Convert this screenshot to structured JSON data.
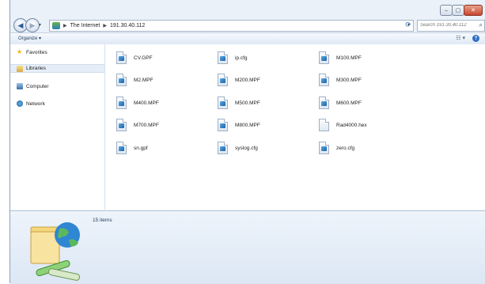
{
  "window": {
    "caption_buttons": [
      "minimize",
      "maximize",
      "close"
    ]
  },
  "address": {
    "crumbs": [
      "The Internet",
      "191.30.40.112"
    ]
  },
  "search": {
    "placeholder": "Search 191.30.40.112"
  },
  "toolbar": {
    "organize_label": "Organize ▾",
    "views_label": "☷ ▾",
    "help_label": "?"
  },
  "navpane": {
    "items": [
      {
        "label": "Favorites",
        "icon": "star-icon"
      },
      {
        "label": "Libraries",
        "icon": "library-icon",
        "selected": true
      },
      {
        "label": "Computer",
        "icon": "computer-icon"
      },
      {
        "label": "Network",
        "icon": "network-icon"
      }
    ]
  },
  "files": [
    {
      "name": "CV.GPF"
    },
    {
      "name": "ip.cfg"
    },
    {
      "name": "M100.MPF"
    },
    {
      "name": "M2.MPF"
    },
    {
      "name": "M200.MPF"
    },
    {
      "name": "M300.MPF"
    },
    {
      "name": "M400.MPF"
    },
    {
      "name": "M500.MPF"
    },
    {
      "name": "M600.MPF"
    },
    {
      "name": "M700.MPF"
    },
    {
      "name": "M800.MPF"
    },
    {
      "name": "Rad4000.hex"
    },
    {
      "name": "sn.gpf"
    },
    {
      "name": "syslog.cfg"
    },
    {
      "name": "zero.cfg"
    }
  ],
  "details": {
    "item_count": "15 items"
  },
  "colors": {
    "accent": "#2c6fc2",
    "selection": "#e5eef8"
  }
}
